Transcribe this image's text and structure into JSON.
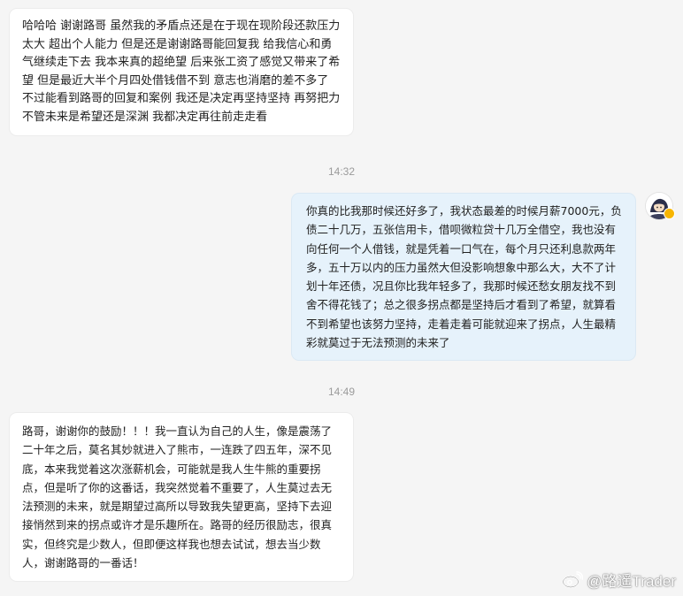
{
  "conversation": {
    "messages": [
      {
        "side": "in",
        "text": "哈哈哈 谢谢路哥 虽然我的矛盾点还是在于现在现阶段还款压力太大 超出个人能力 但是还是谢谢路哥能回复我 给我信心和勇气继续走下去 我本来真的超绝望 后来张工资了感觉又带来了希望 但是最近大半个月四处借钱借不到 意志也消磨的差不多了 不过能看到路哥的回复和案例 我还是决定再坚持坚持 再努把力 不管未来是希望还是深渊 我都决定再往前走走看"
      },
      {
        "side": "out",
        "text": "你真的比我那时候还好多了，我状态最差的时候月薪7000元，负债二十几万，五张信用卡，借呗微粒贷十几万全借空，我也没有向任何一个人借钱，就是凭着一口气在，每个月只还利息款两年多，五十万以内的压力虽然大但没影响想象中那么大，大不了计划十年还债，况且你比我年轻多了，我那时候还愁女朋友找不到舍不得花钱了；总之很多拐点都是坚持后才看到了希望，就算看不到希望也该努力坚持，走着走着可能就迎来了拐点，人生最精彩就莫过于无法预测的未来了"
      },
      {
        "side": "in",
        "text": "路哥，谢谢你的鼓励！！！我一直认为自己的人生，像是震荡了二十年之后，莫名其妙就进入了熊市，一连跌了四五年，深不见底，本来我觉着这次涨薪机会，可能就是我人生牛熊的重要拐点，但是听了你的这番话，我突然觉着不重要了，人生莫过去无法预测的未来，就是期望过高所以导致我失望更高，坚持下去迎接悄然到来的拐点或许才是乐趣所在。路哥的经历很励志，很真实，但终究是少数人，但即便这样我也想去试试，想去当少数人，谢谢路哥的一番话！"
      }
    ],
    "timestamps": [
      "14:32",
      "14:49"
    ]
  },
  "watermark": {
    "icon": "weibo-icon",
    "text": "@路遥Trader"
  },
  "avatar": {
    "icon": "avatar-icon",
    "badge_color": "#f7b500"
  },
  "colors": {
    "background": "#f5f5f5",
    "incoming_bubble": "#ffffff",
    "outgoing_bubble": "#e6f2fb",
    "timestamp_text": "#9b9b9b"
  }
}
